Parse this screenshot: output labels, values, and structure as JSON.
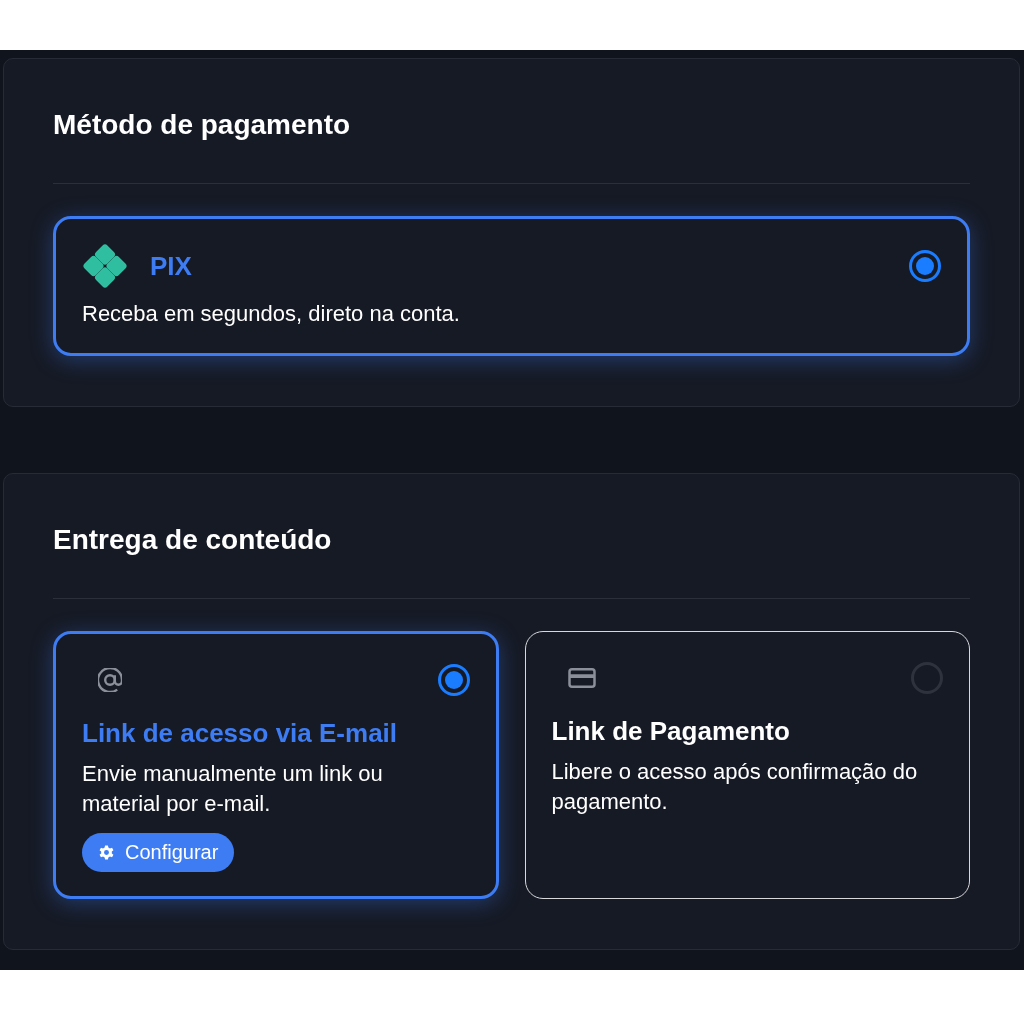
{
  "sections": [
    {
      "title": "Método de pagamento",
      "kind": "single",
      "options": [
        {
          "kind": "pix",
          "title": "PIX",
          "description": "Receba em segundos, direto na conta.",
          "selected": true
        }
      ]
    },
    {
      "title": "Entrega de conteúdo",
      "kind": "double",
      "options": [
        {
          "kind": "at",
          "title": "Link de acesso via E-mail",
          "description": "Envie manualmente um link ou material por e-mail.",
          "selected": true,
          "button": "Configurar"
        },
        {
          "kind": "card",
          "title": "Link de Pagamento",
          "description": "Libere o acesso após confirmação do pagamento.",
          "selected": false
        }
      ]
    }
  ]
}
